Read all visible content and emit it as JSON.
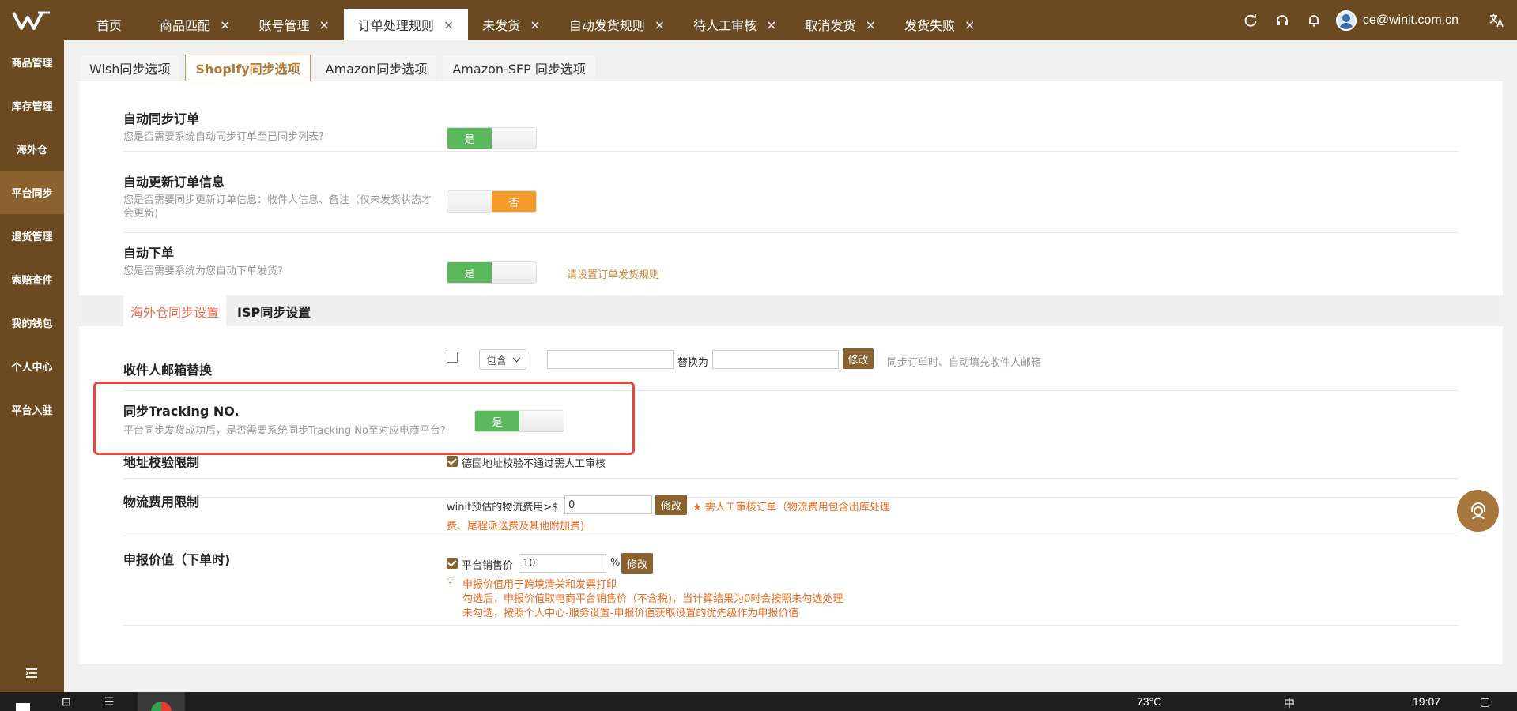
{
  "topbar": {
    "tabs": [
      {
        "label": "首页"
      },
      {
        "label": "商品匹配"
      },
      {
        "label": "账号管理"
      },
      {
        "label": "订单处理规则"
      },
      {
        "label": "未发货"
      },
      {
        "label": "自动发货规则"
      },
      {
        "label": "待人工审核"
      },
      {
        "label": "取消发货"
      },
      {
        "label": "发货失败"
      }
    ],
    "user_email": "ce@winit.com.cn"
  },
  "sidebar": {
    "items": [
      {
        "label": "商品管理"
      },
      {
        "label": "库存管理"
      },
      {
        "label": "海外仓"
      },
      {
        "label": "平台同步"
      },
      {
        "label": "退货管理"
      },
      {
        "label": "索赔查件"
      },
      {
        "label": "我的钱包"
      },
      {
        "label": "个人中心"
      },
      {
        "label": "平台入驻"
      }
    ]
  },
  "subtabs": [
    {
      "label": "Wish同步选项"
    },
    {
      "label": "Shopify同步选项"
    },
    {
      "label": "Amazon同步选项"
    },
    {
      "label": "Amazon-SFP 同步选项"
    }
  ],
  "sections": {
    "auto_sync": {
      "title": "自动同步订单",
      "desc": "您是否需要系统自动同步订单至已同步列表?",
      "toggle": "是"
    },
    "auto_update": {
      "title": "自动更新订单信息",
      "desc": "您是否需要同步更新订单信息：收件人信息、备注（仅未发货状态才会更新)",
      "toggle": "否"
    },
    "auto_order": {
      "title": "自动下单",
      "desc": "您是否需要系统为您自动下单发货?",
      "toggle": "是",
      "link": "请设置订单发货规则"
    }
  },
  "inner_tabs": {
    "active": "海外仓同步设置",
    "other": "ISP同步设置"
  },
  "email_replace": {
    "title": "收件人邮箱替换",
    "select_value": "包含",
    "replace_label": "替换为",
    "button": "修改",
    "hint": "同步订单时、自动填充收件人邮箱"
  },
  "tracking": {
    "title": "同步Tracking NO.",
    "desc": "平台同步发货成功后，是否需要系统同步Tracking No至对应电商平台?",
    "toggle": "是"
  },
  "address": {
    "title": "地址校验限制",
    "check_label": "德国地址校验不通过需人工审核"
  },
  "logistics": {
    "title": "物流费用限制",
    "prefix": "winit预估的物流费用>$",
    "value": "0",
    "button": "修改",
    "note_line1": "需人工审核订单（物流费用包含出库处理",
    "note_line2": "费、尾程派送费及其他附加费)"
  },
  "declare": {
    "title": "申报价值（下单时)",
    "check_label": "平台销售价",
    "value": "10",
    "unit": "%",
    "button": "修改",
    "tip1": "申报价值用于跨境清关和发票打印",
    "tip2": "勾选后，申报价值取电商平台销售价（不含税)，当计算结果为0时会按照未勾选处理",
    "tip3": "未勾选，按照个人中心-服务设置-申报价值获取设置的优先级作为申报价值"
  },
  "taskbar": {
    "temp": "73°C",
    "time": "19:07",
    "ime": "中"
  },
  "colors": {
    "brand": "#6b4a22",
    "accent": "#8a6230",
    "green": "#5cb85c",
    "orange": "#f29b2b",
    "red_highlight": "#e8463c"
  }
}
